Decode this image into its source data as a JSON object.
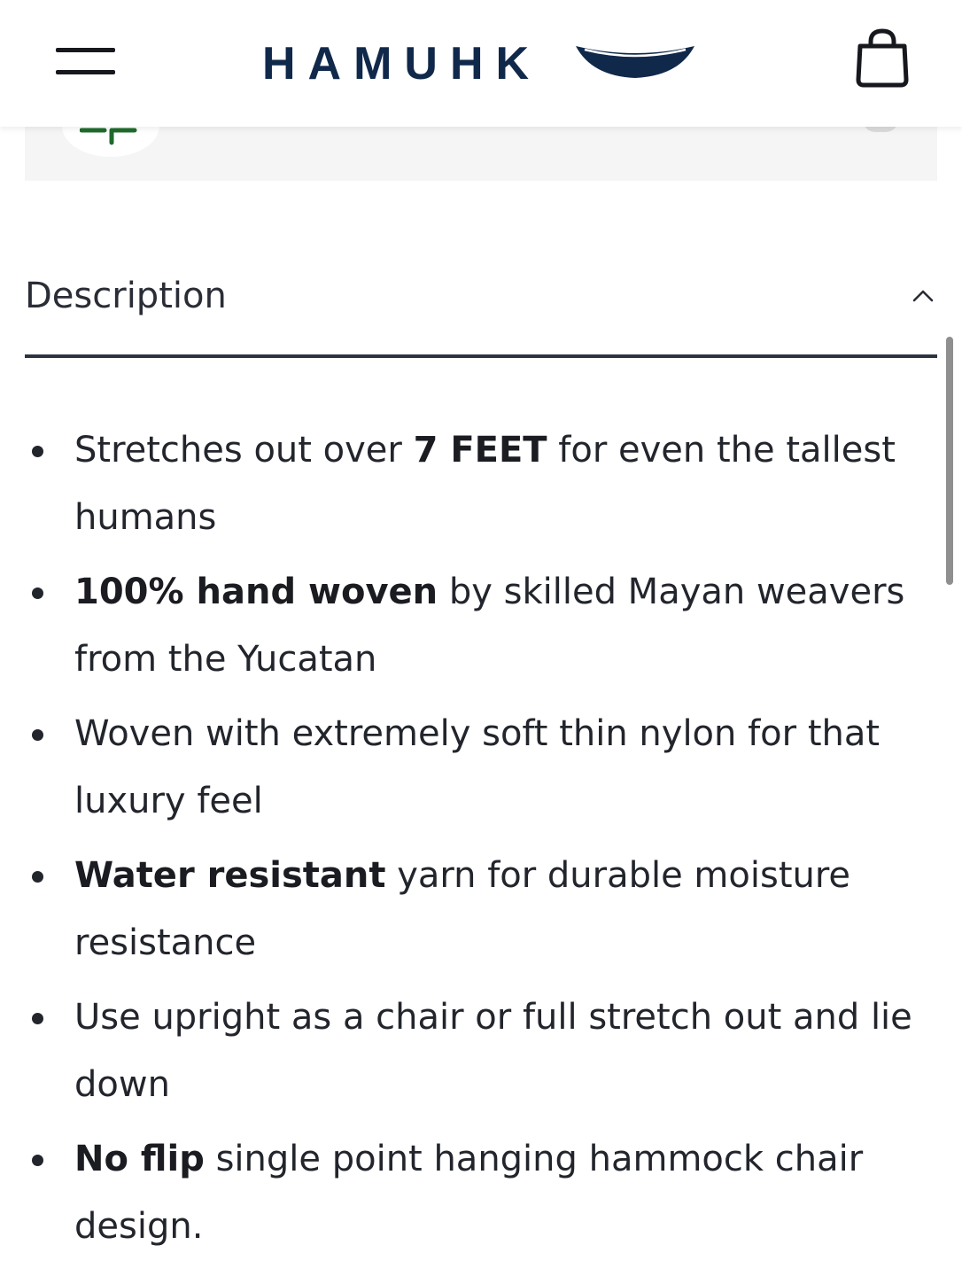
{
  "header": {
    "logo_text": "HAMUHK",
    "menu_icon": "hamburger-menu-icon",
    "cart_icon": "shopping-bag-icon"
  },
  "colors": {
    "brand_navy": "#10284a",
    "text": "#22252c",
    "divider": "#2c3340",
    "logo_green": "#1f6b2c"
  },
  "description": {
    "title": "Description",
    "expanded": true,
    "chevron_icon": "chevron-up-icon",
    "features": [
      {
        "bold": "",
        "lead": "Stretches out over ",
        "em": "7 FEET",
        "tail": " for even the tallest humans"
      },
      {
        "bold": "100% hand woven",
        "lead": " by skilled Mayan weavers from the Yucatan",
        "em": "",
        "tail": ""
      },
      {
        "bold": "",
        "lead": "Woven with extremely soft thin nylon for that luxury feel",
        "em": "",
        "tail": ""
      },
      {
        "bold": "Water resistant",
        "lead": " yarn for durable moisture resistance",
        "em": "",
        "tail": ""
      },
      {
        "bold": "",
        "lead": "Use upright as a chair or full stretch out and lie down",
        "em": "",
        "tail": ""
      },
      {
        "bold": "No flip",
        "lead": " single point hanging hammock chair design.",
        "em": "",
        "tail": ""
      }
    ]
  }
}
